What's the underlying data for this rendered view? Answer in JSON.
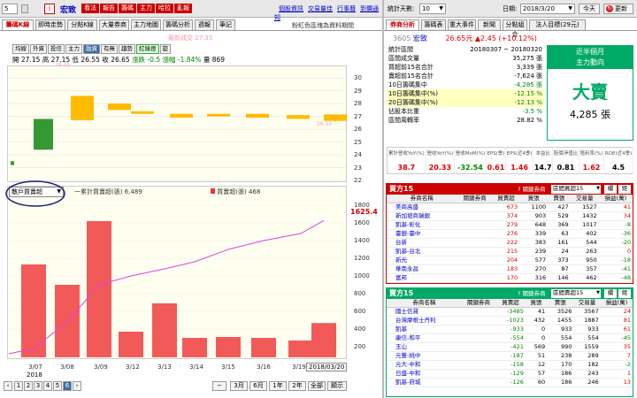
{
  "topbar": {
    "stock_input": "5",
    "stock_name": "宏致",
    "red_buttons": [
      "看法",
      "報告",
      "籌碼",
      "主力",
      "哈拉",
      "亂報"
    ],
    "links": [
      "個股資訊",
      "交易量佳",
      "行事曆",
      "到價通知"
    ]
  },
  "left_tabs": [
    "籌碼K線",
    "即時走勢",
    "分點K線",
    "大量券商",
    "主力地圖",
    "籌碼分析",
    "週報",
    "筆記"
  ],
  "left_note": "粉紅色區塊為資料期間",
  "indicator_buttons": [
    "均線",
    "外資",
    "投信",
    "主力",
    "融資",
    "有無",
    "趨勢",
    "紅綠燈",
    "旋"
  ],
  "k_legend": {
    "label": "最新成交",
    "value": "27.35"
  },
  "ohlc": {
    "open_label": "開",
    "open": "27.15",
    "high_label": "高",
    "high": "27.15",
    "low_label": "低",
    "low": "26.55",
    "close_label": "收",
    "close": "26.65",
    "change_label": "漲跌",
    "change": "-0.5",
    "pct_label": "漲幅",
    "pct": "-1.84%",
    "vol_label": "量",
    "vol": "869"
  },
  "k_yticks": [
    "30",
    "29",
    "28",
    "27",
    "26",
    "25",
    "24",
    "23",
    "22"
  ],
  "k_label_high": "28.55",
  "k_label_low": "26.55",
  "lower_select": "散戶買賣超",
  "lower_legend": {
    "line_label": "一累計買賣超(張)",
    "line_value": "6,489",
    "bar_label": "買賣超(張)",
    "bar_value": "468"
  },
  "lower_last": "1625.4",
  "lower_yticks": [
    "1800",
    "1600",
    "1400",
    "1200",
    "1000",
    "800",
    "600",
    "400",
    "200"
  ],
  "x_dates": [
    "3/07",
    "3/08",
    "3/09",
    "3/12",
    "3/13",
    "3/14",
    "3/15",
    "3/16",
    "3/19"
  ],
  "x_year": "2018",
  "x_last_date": "2018/03/20",
  "chart_data": [
    {
      "type": "candlestick",
      "x": [
        "3/07",
        "3/08",
        "3/09",
        "3/12",
        "3/13",
        "3/14",
        "3/15",
        "3/16",
        "3/19",
        "3/20"
      ],
      "open": [
        23.5,
        24.4,
        28.6,
        28.0,
        27.4,
        27.2,
        27.2,
        27.2,
        27.1,
        27.15
      ],
      "close": [
        23.2,
        26.8,
        26.7,
        27.5,
        27.2,
        26.9,
        27.0,
        26.9,
        26.8,
        26.65
      ],
      "high": [
        23.5,
        26.8,
        28.6,
        28.0,
        27.4,
        27.2,
        27.2,
        27.2,
        27.1,
        27.15
      ],
      "low": [
        23.2,
        24.4,
        26.7,
        27.5,
        27.2,
        26.9,
        27.0,
        26.9,
        26.8,
        26.55
      ],
      "ylim": [
        22,
        30.7
      ]
    },
    {
      "type": "bar+line",
      "x": [
        "3/07",
        "3/08",
        "3/09",
        "3/12",
        "3/13",
        "3/14",
        "3/15",
        "3/16",
        "3/19",
        "3/20"
      ],
      "series": [
        {
          "name": "買賣超(張)",
          "values": [
            1130,
            900,
            1620,
            370,
            690,
            300,
            310,
            300,
            270,
            468
          ]
        },
        {
          "name": "累計買賣超(張)",
          "values": [
            180,
            480,
            900,
            1000,
            1080,
            1160,
            1300,
            1400,
            1480,
            1625.4
          ]
        }
      ],
      "ylim": [
        80,
        1900
      ]
    }
  ],
  "right_top": {
    "days_label": "統計天數:",
    "days_value": "10",
    "date_label": "日期:",
    "date_value": "2018/3/20",
    "today_btn": "今天",
    "refresh_btn": "更新"
  },
  "right_tabs": [
    "券商分析",
    "籌碼表",
    "重大事件",
    "新聞",
    "分點組合",
    "法人目標(29元)"
  ],
  "stock_header": {
    "code": "3605",
    "name": "宏致",
    "price": "26.65元",
    "change": "▲2.45 (+10.12%)"
  },
  "stats": [
    {
      "label": "統計區間",
      "value": "20180307 ~ 20180320"
    },
    {
      "label": "區間成交量",
      "value": "35,275 張"
    },
    {
      "label": "買超前15名合計",
      "value": "3,339 張"
    },
    {
      "label": "賣超前15名合計",
      "value": "-7,624 張"
    },
    {
      "label": "10日籌碼集中",
      "value": "-4,285 張"
    },
    {
      "label": "10日籌碼集中(%)",
      "value": "-12.15 %"
    },
    {
      "label": "20日籌碼集中(%)",
      "value": "-12.13 %"
    },
    {
      "label": "佔股本比重",
      "value": "-3.5 %"
    },
    {
      "label": "區間周轉率",
      "value": "28.82 %"
    }
  ],
  "green_box": {
    "title1": "近半個月",
    "title2": "主力動向",
    "big": "大賣",
    "amount": "4,285 張"
  },
  "fin_headers": [
    "累計營收YoY(%)",
    "營收YoY(%)",
    "營收MoM(%)",
    "EPS(季)",
    "EPS(近4季)",
    "本益比",
    "股價淨值比",
    "殖利率(%)",
    "ROE(近4季)"
  ],
  "fin_values": [
    "38.7",
    "20.33",
    "-32.54",
    "0.61",
    "1.46",
    "14.7",
    "0.81",
    "1.62",
    "4.5"
  ],
  "buy_header": {
    "title": "買方15",
    "q_label": "關鍵券商",
    "filter": "區間買超15",
    "btn1": "欄",
    "btn2": "鉅"
  },
  "sell_header": {
    "title": "賣方15",
    "q_label": "關鍵券商",
    "filter": "區間賣超15",
    "btn1": "欄",
    "btn2": "鉅"
  },
  "table_cols": [
    "券商名稱",
    "關鍵券商",
    "買賣超",
    "買張",
    "賣張",
    "交易量",
    "損益(萬)"
  ],
  "buy_rows": [
    [
      "美商高盛",
      "",
      "673",
      "1100",
      "427",
      "1527",
      "41"
    ],
    [
      "新加坡商瑞銀",
      "",
      "374",
      "903",
      "529",
      "1432",
      "34"
    ],
    [
      "凱基-彰化",
      "",
      "279",
      "648",
      "369",
      "1017",
      "-8"
    ],
    [
      "臺銀-臺中",
      "",
      "276",
      "339",
      "63",
      "402",
      "-36"
    ],
    [
      "台新",
      "",
      "222",
      "383",
      "161",
      "544",
      "-20"
    ],
    [
      "凱基-台北",
      "",
      "215",
      "239",
      "24",
      "263",
      "0"
    ],
    [
      "新光",
      "",
      "204",
      "577",
      "373",
      "950",
      "-18"
    ],
    [
      "華南永昌",
      "",
      "183",
      "270",
      "87",
      "357",
      "-41"
    ],
    [
      "富邦",
      "",
      "170",
      "316",
      "146",
      "462",
      "-48"
    ]
  ],
  "sell_rows": [
    [
      "國士信貸",
      "",
      "-3485",
      "41",
      "3526",
      "3567",
      "24"
    ],
    [
      "台灣摩根士丹利",
      "",
      "-1023",
      "432",
      "1455",
      "1887",
      "81"
    ],
    [
      "凱基",
      "",
      "-933",
      "0",
      "933",
      "933",
      "61"
    ],
    [
      "康信-和平",
      "",
      "-554",
      "0",
      "554",
      "554",
      "-45"
    ],
    [
      "玉山",
      "",
      "-421",
      "569",
      "990",
      "1559",
      "35"
    ],
    [
      "元豐-桃中",
      "",
      "-187",
      "51",
      "238",
      "289",
      "7"
    ],
    [
      "元大-中和",
      "",
      "-158",
      "12",
      "170",
      "182",
      "-2"
    ],
    [
      "日盛-中和",
      "",
      "-129",
      "57",
      "186",
      "243",
      "1"
    ],
    [
      "凱基-府城",
      "",
      "-126",
      "60",
      "186",
      "246",
      "13"
    ]
  ],
  "page_buttons": [
    "1",
    "2",
    "3",
    "4",
    "5",
    "6"
  ],
  "range_buttons": [
    "3月",
    "6月",
    "1年",
    "2年",
    "全部",
    "顯示"
  ]
}
